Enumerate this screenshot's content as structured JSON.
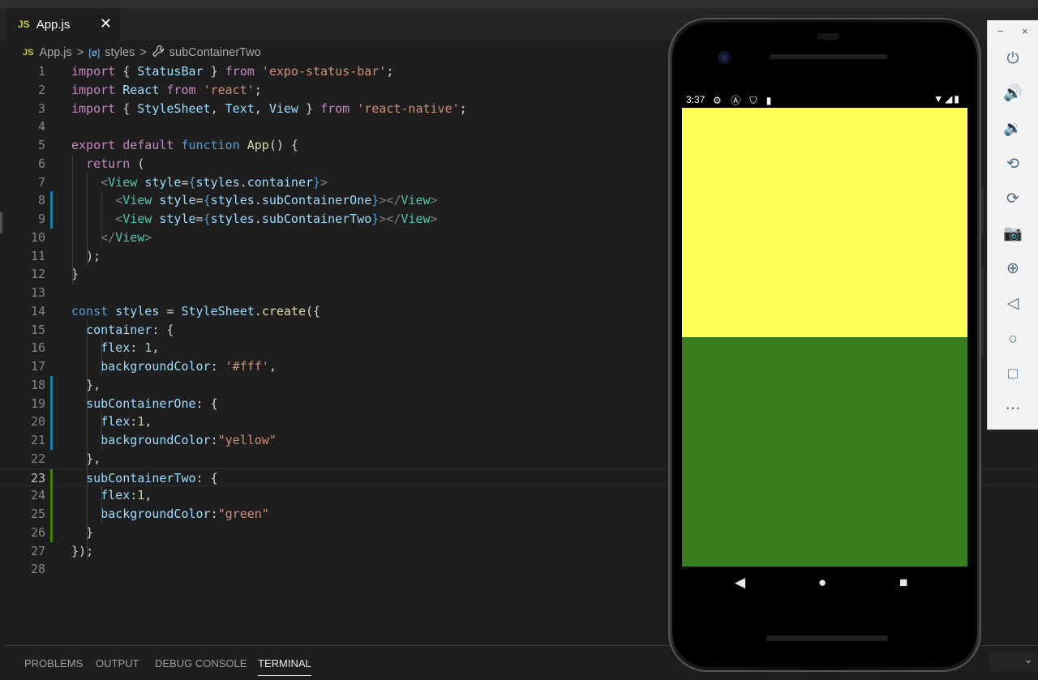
{
  "tab": {
    "badge": "JS",
    "filename": "App.js",
    "close": "✕"
  },
  "breadcrumb": {
    "badge": "JS",
    "file": "App.js",
    "sep": ">",
    "symbol_icon": "[ø]",
    "symbol": "styles",
    "member_icon": "wrench-icon",
    "member": "subContainerTwo"
  },
  "code_lines": [
    "import { StatusBar } from 'expo-status-bar';",
    "import React from 'react';",
    "import { StyleSheet, Text, View } from 'react-native';",
    "",
    "export default function App() {",
    "  return (",
    "    <View style={styles.container}>",
    "      <View style={styles.subContainerOne}></View>",
    "      <View style={styles.subContainerTwo}></View>",
    "    </View>",
    "  );",
    "}",
    "",
    "const styles = StyleSheet.create({",
    "  container: {",
    "    flex: 1,",
    "    backgroundColor: '#fff',",
    "  },",
    "  subContainerOne: {",
    "    flex:1,",
    "    backgroundColor:\"yellow\"",
    "  },",
    "  subContainerTwo: {",
    "    flex:1,",
    "    backgroundColor:\"green\"",
    "  }",
    "});",
    ""
  ],
  "panel_tabs": [
    "PROBLEMS",
    "OUTPUT",
    "DEBUG CONSOLE",
    "TERMINAL"
  ],
  "active_panel_tab": "TERMINAL",
  "phone": {
    "time": "3:37",
    "status_icons_left": "⚙ Ⓐ ⛉ ▮",
    "status_icons_right": "▼◢▮",
    "top_color": "#ffff55",
    "bottom_color": "#387e21",
    "nav": {
      "back": "◀",
      "home": "●",
      "recents": "■"
    }
  },
  "emulator_toolbar": {
    "minimize": "−",
    "close": "×",
    "buttons": [
      {
        "name": "power-icon",
        "glyph": "⏻"
      },
      {
        "name": "volume-up-icon",
        "glyph": "🔊"
      },
      {
        "name": "volume-down-icon",
        "glyph": "🔉"
      },
      {
        "name": "rotate-left-icon",
        "glyph": "⟲"
      },
      {
        "name": "rotate-right-icon",
        "glyph": "⟳"
      },
      {
        "name": "camera-icon",
        "glyph": "📷"
      },
      {
        "name": "zoom-icon",
        "glyph": "⊕"
      },
      {
        "name": "back-icon",
        "glyph": "◁"
      },
      {
        "name": "home-icon",
        "glyph": "○"
      },
      {
        "name": "overview-icon",
        "glyph": "□"
      },
      {
        "name": "more-icon",
        "glyph": "⋯"
      }
    ]
  }
}
